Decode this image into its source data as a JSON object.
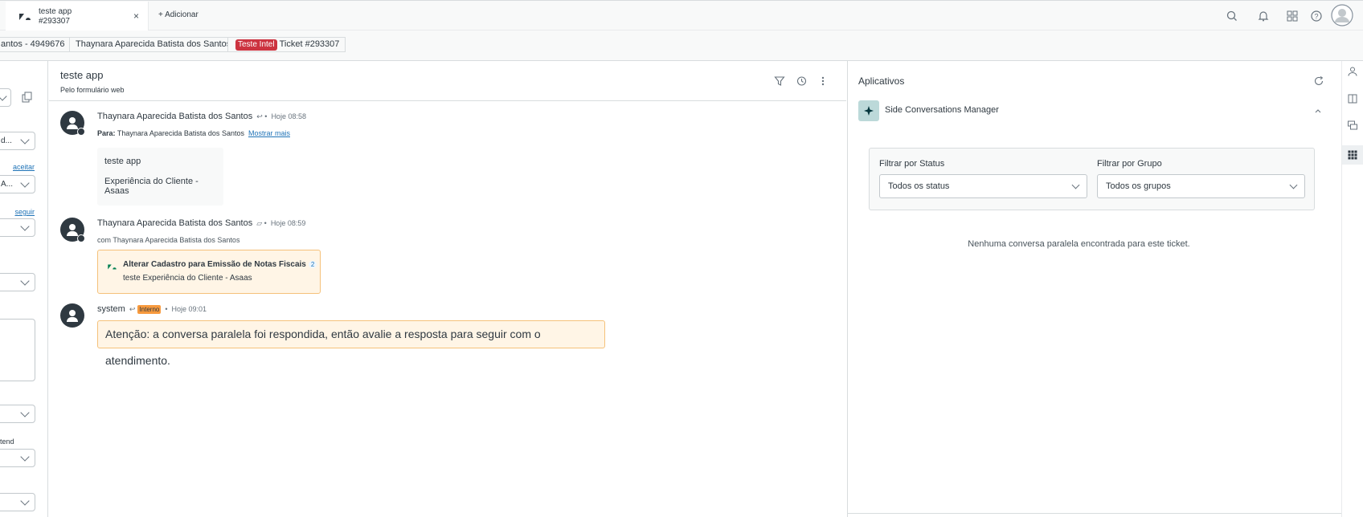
{
  "tab": {
    "title_line1": "teste app",
    "title_line2": "#293307",
    "close": "×",
    "add_label": "Adicionar"
  },
  "breadcrumbs": [
    {
      "label": "antos - 4949676"
    },
    {
      "label": "Thaynara Aparecida Batista dos Santos"
    },
    {
      "badge": "Teste Intel",
      "label": "Ticket #293307"
    }
  ],
  "left": {
    "select1": "",
    "select2": "d...",
    "link1": "aceitar",
    "select3": "A...",
    "link2": "seguir",
    "label_tend": "tend"
  },
  "ticket": {
    "title": "teste app",
    "channel": "Pelo formulário web"
  },
  "messages": [
    {
      "author": "Thaynara Aparecida Batista dos Santos",
      "time": "Hoje 08:58",
      "to_label": "Para:",
      "to": "Thaynara Aparecida Batista dos Santos",
      "show_more": "Mostrar mais",
      "body_line1": "teste app",
      "body_line2": "Experiência do Cliente - Asaas"
    },
    {
      "author": "Thaynara Aparecida Batista dos Santos",
      "time": "Hoje 08:59",
      "with": "com Thaynara Aparecida Batista dos Santos",
      "card_title": "Alterar Cadastro para Emissão de Notas Fiscais",
      "card_count": "2",
      "card_body": "teste Experiência do Cliente - Asaas"
    },
    {
      "author": "system",
      "badge": "Interno",
      "time": "Hoje 09:01",
      "alert": "Atenção: a conversa paralela foi respondida, então avalie a resposta para seguir com o atendimento."
    }
  ],
  "apps": {
    "title": "Aplicativos",
    "app_name": "Side Conversations Manager",
    "filter_status_label": "Filtrar por Status",
    "filter_status_value": "Todos os status",
    "filter_group_label": "Filtrar por Grupo",
    "filter_group_value": "Todos os grupos",
    "empty": "Nenhuma conversa paralela encontrada para este ticket."
  },
  "colors": {
    "accent": "#1f73b7",
    "danger": "#cc3340",
    "warning_bg": "#fff5e6",
    "warning_border": "#f5c17a",
    "dark": "#2f3941"
  }
}
